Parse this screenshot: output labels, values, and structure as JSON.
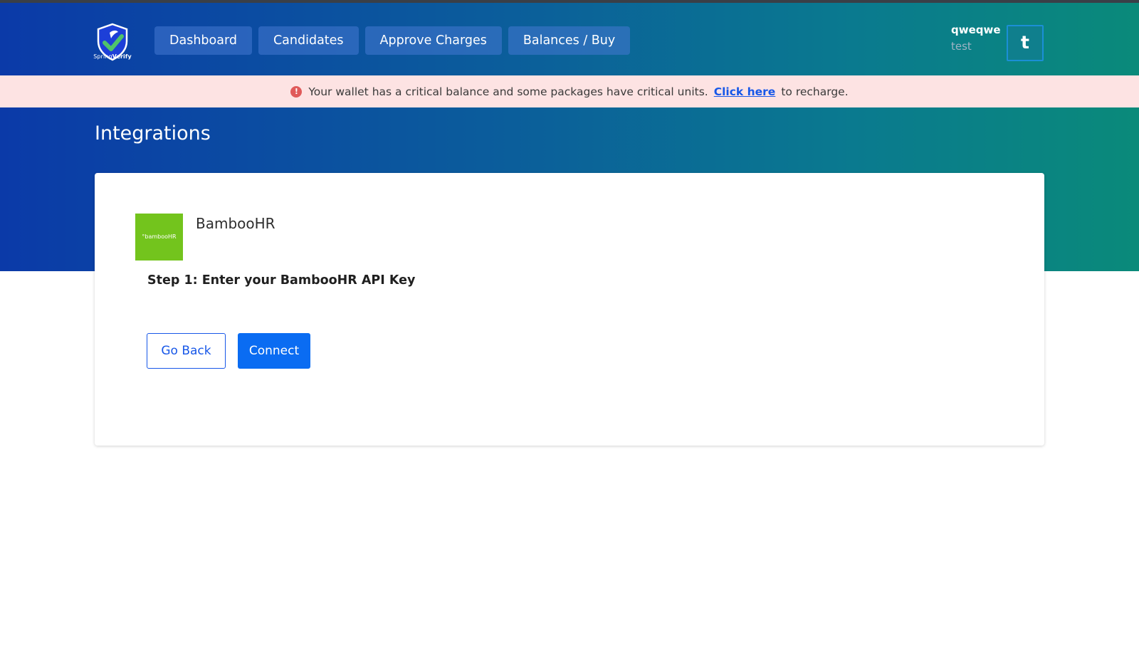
{
  "brand": {
    "logo_prefix": "Spring",
    "logo_suffix": "Verify",
    "shield_color": "#1d3fd8",
    "check_color": "#4fc36b"
  },
  "nav": {
    "items": [
      {
        "label": "Dashboard"
      },
      {
        "label": "Candidates"
      },
      {
        "label": "Approve Charges"
      },
      {
        "label": "Balances / Buy"
      }
    ]
  },
  "user": {
    "name": "qweqwe",
    "org": "test",
    "avatar_initial": "t"
  },
  "alert": {
    "icon": "exclamation-circle-icon",
    "message": "Your wallet has a critical balance and some packages have critical units.",
    "link_text": "Click here",
    "suffix": "to recharge."
  },
  "page": {
    "title": "Integrations"
  },
  "integration": {
    "name": "BambooHR",
    "logo_text": "°bambooHR",
    "logo_color": "#73c41d",
    "step_label": "Step 1: Enter your BambooHR API Key"
  },
  "actions": {
    "back_label": "Go Back",
    "connect_label": "Connect"
  }
}
